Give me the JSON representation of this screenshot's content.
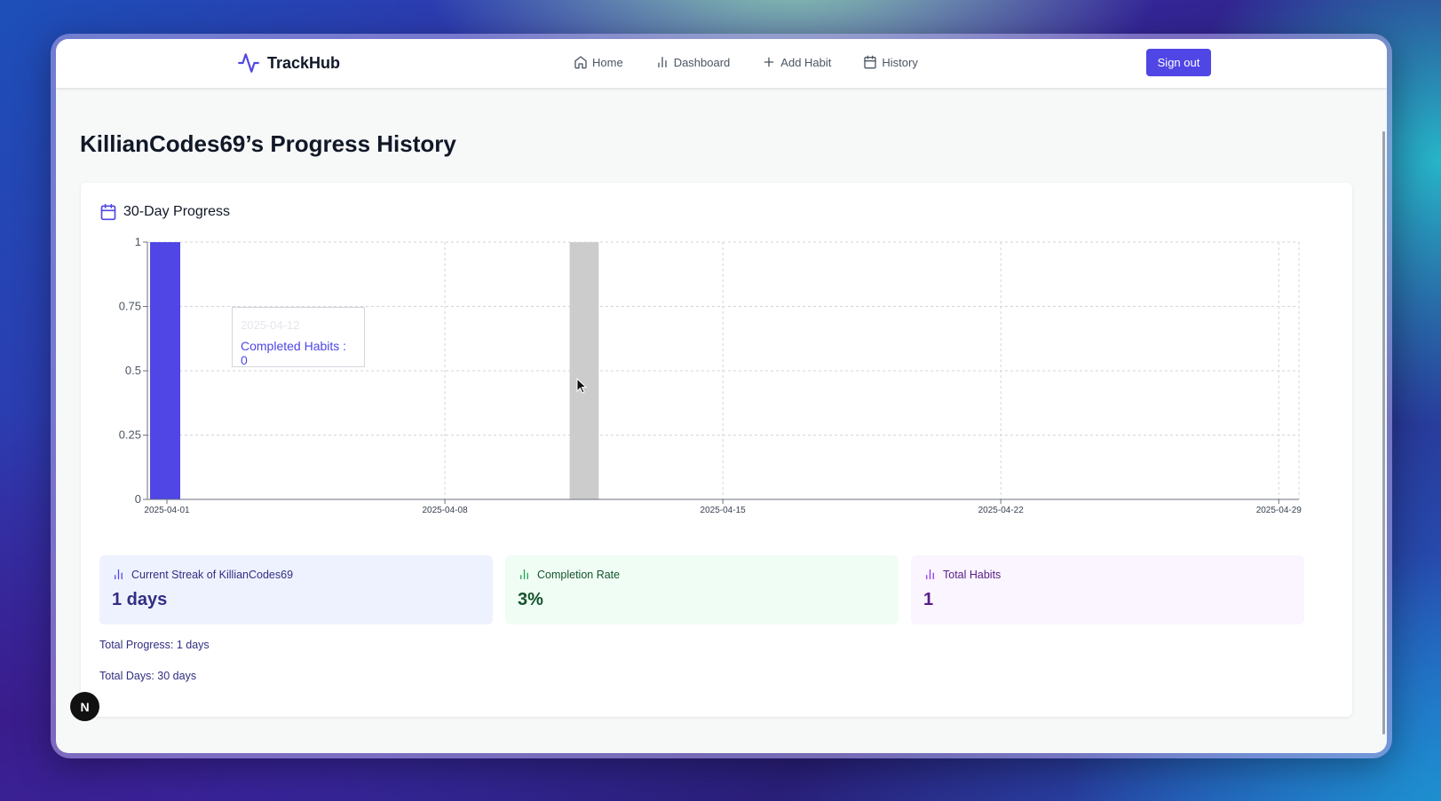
{
  "nav": {
    "brand": "TrackHub",
    "links": [
      {
        "label": "Home",
        "icon": "home-icon"
      },
      {
        "label": "Dashboard",
        "icon": "bar-chart-icon"
      },
      {
        "label": "Add Habit",
        "icon": "plus-icon"
      },
      {
        "label": "History",
        "icon": "calendar-icon"
      }
    ],
    "signout_label": "Sign out"
  },
  "page": {
    "title": "KillianCodes69’s Progress History"
  },
  "card": {
    "title": "30-Day Progress"
  },
  "chart_data": {
    "type": "bar",
    "series": [
      {
        "name": "Completed Habits",
        "color": "#4f46e5"
      }
    ],
    "x_ticks": [
      "2025-04-01",
      "2025-04-08",
      "2025-04-15",
      "2025-04-22",
      "2025-04-29"
    ],
    "y_ticks": [
      "0",
      "0.25",
      "0.5",
      "0.75",
      "1"
    ],
    "ylim": [
      0,
      1
    ],
    "xlim": [
      "2025-04-01",
      "2025-04-30"
    ],
    "bars": [
      {
        "date": "2025-04-01",
        "value": 1
      }
    ],
    "highlight": {
      "date": "2025-04-12",
      "color": "#cccccc"
    },
    "tooltip": {
      "date": "2025-04-12",
      "text": "Completed Habits : 0"
    },
    "grid": true
  },
  "stats": {
    "streak": {
      "label": "Current Streak of KillianCodes69",
      "value": "1 days"
    },
    "completion": {
      "label": "Completion Rate",
      "value": "3%"
    },
    "habits": {
      "label": "Total Habits",
      "value": "1"
    }
  },
  "totals": {
    "progress": "Total Progress: 1 days",
    "days": "Total Days: 30 days"
  },
  "badge": "N"
}
